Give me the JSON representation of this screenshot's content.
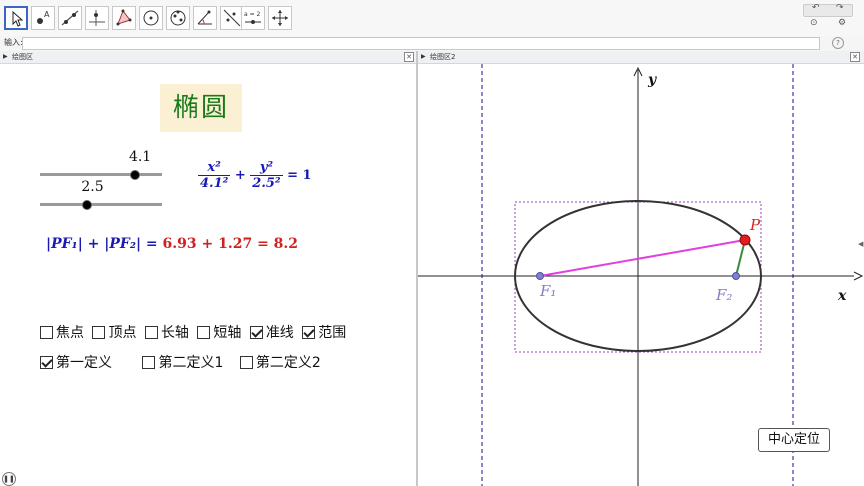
{
  "toolbar": {
    "tools": [
      "move-tool",
      "point-tool",
      "line-tool",
      "perpendicular-tool",
      "polygon-tool",
      "circle-tool",
      "conic-tool",
      "angle-tool",
      "reflect-tool",
      "slider-tool",
      "move-view-tool"
    ],
    "slider_tool_text": "a = 2",
    "undo_icon": "undo-icon",
    "redo_icon": "redo-icon",
    "help_icon": "help-icon",
    "settings_icon": "gear-icon"
  },
  "inputbar": {
    "label": "输入:"
  },
  "panels": {
    "left_title": "绘图区",
    "right_title": "绘图区2"
  },
  "title": "椭圆",
  "sliders": [
    {
      "value": "4.1",
      "fraction": 0.77
    },
    {
      "value": "2.5",
      "fraction": 0.38
    }
  ],
  "equation": {
    "num1": "x²",
    "den1": "4.1²",
    "plus": "+",
    "num2": "y²",
    "den2": "2.5²",
    "rhs": "= 1"
  },
  "sum_eq": {
    "lhs": "|PF₁| + |PF₂| = ",
    "rhs": "6.93 + 1.27 = 8.2"
  },
  "checkboxes_row1": [
    {
      "label": "焦点",
      "checked": false
    },
    {
      "label": "顶点",
      "checked": false
    },
    {
      "label": "长轴",
      "checked": false
    },
    {
      "label": "短轴",
      "checked": false
    },
    {
      "label": "准线",
      "checked": true
    },
    {
      "label": "范围",
      "checked": true
    }
  ],
  "checkboxes_row2": [
    {
      "label": "第一定义",
      "checked": true
    },
    {
      "label": "第二定义1",
      "checked": false
    },
    {
      "label": "第二定义2",
      "checked": false
    }
  ],
  "graph": {
    "axis_x": "x",
    "axis_y": "y",
    "focus1": "F₁",
    "focus2": "F₂",
    "point": "P",
    "colors": {
      "ellipse": "#333333",
      "directrix": "#3a3aa8",
      "pf1": "#e040e0",
      "pf2": "#3a8a3a",
      "point": "#e02020",
      "focus": "#8080d0"
    }
  },
  "center_button": "中心定位"
}
